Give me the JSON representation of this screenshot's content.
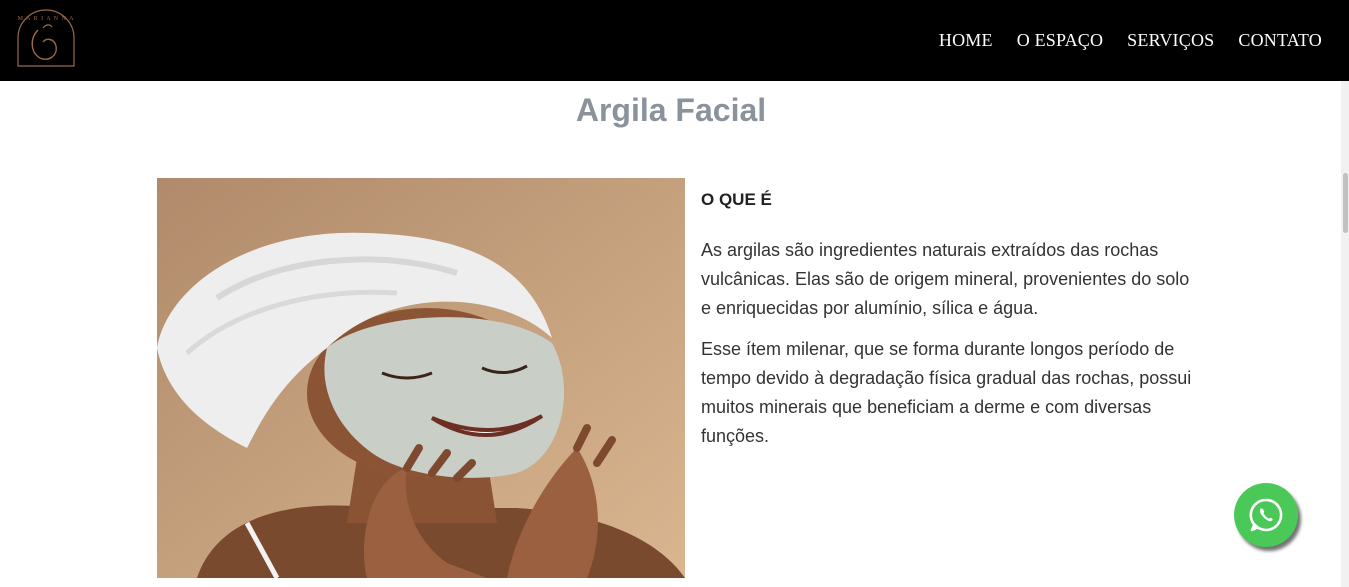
{
  "header": {
    "logo_text": "MARIANNA AMORIM",
    "nav": [
      "HOME",
      "O ESPAÇO",
      "SERVIÇOS",
      "CONTATO"
    ]
  },
  "page": {
    "title": "Argila Facial",
    "section_heading": "O QUE É",
    "paragraphs": [
      "As argilas são ingredientes naturais extraídos das rochas vulcânicas. Elas são de origem mineral, provenientes do solo e enriquecidas por alumínio, sílica e água.",
      "Esse ítem milenar, que se forma durante longos período de tempo devido à degradação física gradual das rochas, possui muitos minerais que beneficiam a derme e com diversas funções."
    ]
  },
  "colors": {
    "header_bg": "#000000",
    "title": "#8a929c",
    "whatsapp": "#4ac959"
  },
  "icons": [
    "logo-emblem",
    "whatsapp-icon"
  ]
}
